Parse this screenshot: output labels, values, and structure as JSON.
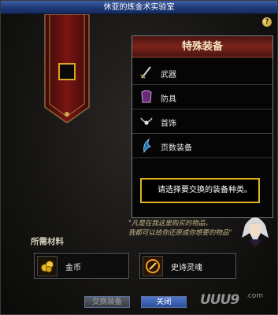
{
  "window": {
    "title": "休亚的炼金术实验室",
    "help_label": "?"
  },
  "equip_panel": {
    "header": "特殊装备",
    "items": [
      {
        "label": "武器",
        "icon": "sword-icon"
      },
      {
        "label": "防具",
        "icon": "armor-icon"
      },
      {
        "label": "首饰",
        "icon": "necklace-icon"
      },
      {
        "label": "页数装备",
        "icon": "special-equipment-icon"
      }
    ]
  },
  "tooltip": {
    "text": "请选择要交换的装备种类。"
  },
  "npc": {
    "quote_line1": "\"凡是在我这里购买的物品，",
    "quote_line2": "我都可以给你还原成你想要的物品\""
  },
  "materials": {
    "title": "所需材料",
    "items": [
      {
        "label": "金币",
        "icon": "gold-coins-icon"
      },
      {
        "label": "史诗灵魂",
        "icon": "epic-soul-icon"
      }
    ]
  },
  "buttons": {
    "exchange": "交换装备",
    "close": "关闭"
  },
  "watermark": {
    "text1": "UUU9",
    "text2": ".com"
  },
  "colors": {
    "title_bar": "#2a4a8e",
    "header_red": "#7b231b",
    "tooltip_border": "#e0b21e",
    "slot_border": "#d6a825"
  }
}
